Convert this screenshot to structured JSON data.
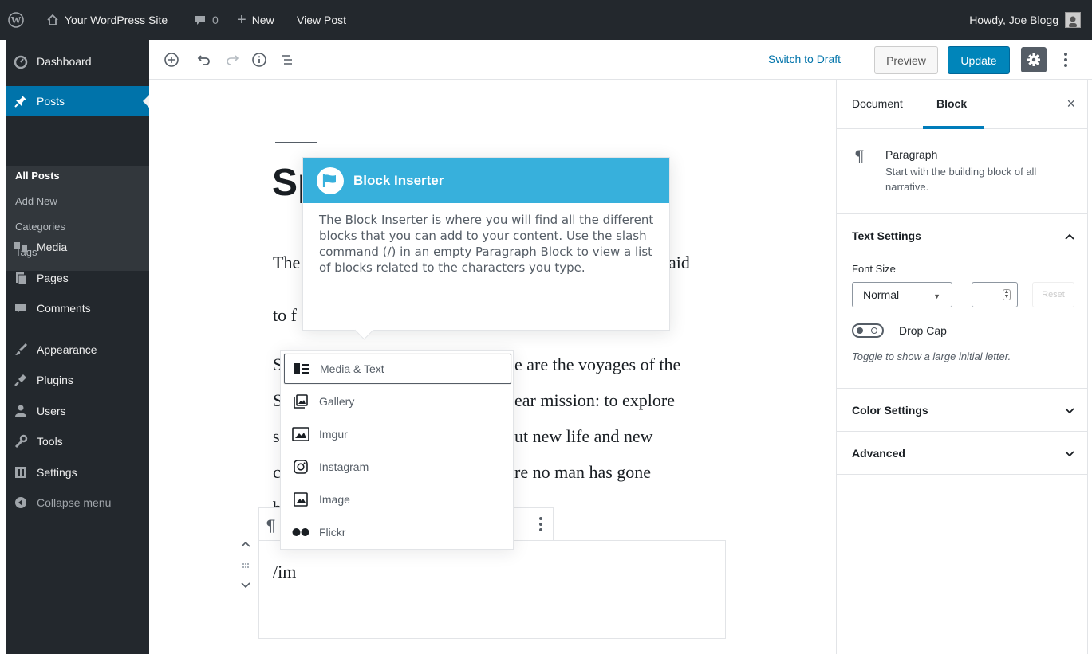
{
  "adminbar": {
    "site_name": "Your WordPress Site",
    "comments_count": "0",
    "new_label": "New",
    "view_post": "View Post",
    "howdy": "Howdy, Joe Blogg"
  },
  "sidebar": {
    "dashboard": "Dashboard",
    "posts": "Posts",
    "submenu": [
      "All Posts",
      "Add New",
      "Categories",
      "Tags"
    ],
    "media": "Media",
    "pages": "Pages",
    "comments": "Comments",
    "appearance": "Appearance",
    "plugins": "Plugins",
    "users": "Users",
    "tools": "Tools",
    "settings": "Settings",
    "collapse": "Collapse menu"
  },
  "toolbar": {
    "switch_to_draft": "Switch to Draft",
    "preview": "Preview",
    "update": "Update"
  },
  "editor": {
    "title_visible": "Sp",
    "para1": [
      "The",
      "aid",
      "to f"
    ],
    "para2": [
      "S",
      "e are the voyages of the",
      "S",
      "ear mission: to explore",
      "s",
      "ut new life and new",
      "c",
      "re no man has gone",
      "b"
    ],
    "typed": "/im"
  },
  "tip": {
    "title": "Block Inserter",
    "body": "The Block Inserter is where you will find all the different blocks that you can add to your content. Use the slash command (/) in an empty Paragraph Block to view a list of blocks related to the characters you type."
  },
  "autocomplete": {
    "items": [
      {
        "label": "Media & Text",
        "icon": "media-text-icon",
        "selected": true
      },
      {
        "label": "Gallery",
        "icon": "gallery-icon"
      },
      {
        "label": "Imgur",
        "icon": "imgur-icon"
      },
      {
        "label": "Instagram",
        "icon": "instagram-icon"
      },
      {
        "label": "Image",
        "icon": "image-icon"
      },
      {
        "label": "Flickr",
        "icon": "flickr-icon"
      }
    ]
  },
  "settings": {
    "tab_document": "Document",
    "tab_block": "Block",
    "close": "×",
    "block_name": "Paragraph",
    "block_desc": "Start with the building block of all narrative.",
    "text_settings": "Text Settings",
    "font_size_label": "Font Size",
    "font_size_value": "Normal",
    "reset": "Reset",
    "drop_cap": "Drop Cap",
    "drop_cap_help": "Toggle to show a large initial letter.",
    "color_settings": "Color Settings",
    "advanced": "Advanced"
  },
  "colors": {
    "admin_dark": "#23282d",
    "accent_blue": "#0073aa",
    "update_blue": "#0085ba",
    "tip_blue": "#37b0dc"
  }
}
